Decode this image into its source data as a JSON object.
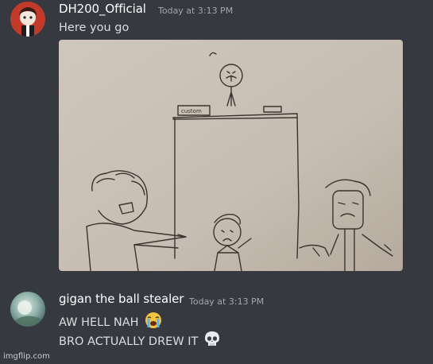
{
  "messages": [
    {
      "author": "DH200_Official",
      "timestamp": "Today at 3:13 PM",
      "lines": [
        "Here you go"
      ],
      "attachment": {
        "sign_text": "custom"
      },
      "colors": {
        "avatar_bg": "#c23a2a"
      }
    },
    {
      "author": "gigan the ball stealer",
      "timestamp": "Today at 3:13 PM",
      "lines": [
        "AW HELL NAH",
        "BRO ACTUALLY DREW IT"
      ],
      "line_emojis": [
        "loudly-crying-face-emoji",
        "skull-emoji"
      ],
      "colors": {
        "avatar_bg": "#7fa0a6"
      }
    }
  ],
  "watermark": "imgflip.com",
  "theme": {
    "background": "#36393f",
    "username": "#ffffff",
    "text": "#dcddde",
    "timestamp": "#a3a6aa"
  }
}
